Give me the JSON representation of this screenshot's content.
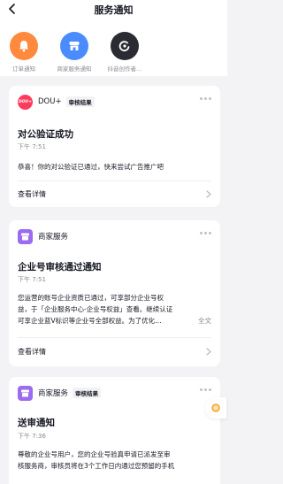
{
  "header": {
    "title": "服务通知"
  },
  "shortcuts": [
    {
      "label": "订单通知",
      "icon": "bell-icon",
      "color": "#ff8a3d"
    },
    {
      "label": "商家服务通知",
      "icon": "shop-icon",
      "color": "#4a8cff"
    },
    {
      "label": "抖音创作者…",
      "icon": "creator-icon",
      "color": "#2b2b33"
    }
  ],
  "cards": [
    {
      "sender": "DOU+",
      "logo_text": "DOU+",
      "tag": "审核结果",
      "title": "对公验证成功",
      "time": "下午 7:51",
      "body": "恭喜！你的对公验证已通过，快来尝试广告推广吧",
      "detail_label": "查看详情"
    },
    {
      "sender": "商家服务",
      "title": "企业号审核通过通知",
      "time": "下午 7:51",
      "body_lines": [
        "您运营的账号企业资质已通过，可享部分企业号权",
        "益，于「企业服务中心-企业号权益」查看。继续认证",
        "可享企业蓝V标识等企业号全部权益。为了优化…"
      ],
      "expand_label": "全文",
      "detail_label": "查看详情"
    },
    {
      "sender": "商家服务",
      "tag": "审核结果",
      "title": "送审通知",
      "time": "下午 7:36",
      "body_lines": [
        "尊敬的企业号用户，您的企业号验真申请已派发至审",
        "核服务商，审核员将在3个工作日内通过您预留的手机"
      ]
    }
  ],
  "colors": {
    "dou_logo": "#ff3b5c",
    "shop_logo": "#9b6bf2",
    "float_accent": "#f7b955"
  }
}
